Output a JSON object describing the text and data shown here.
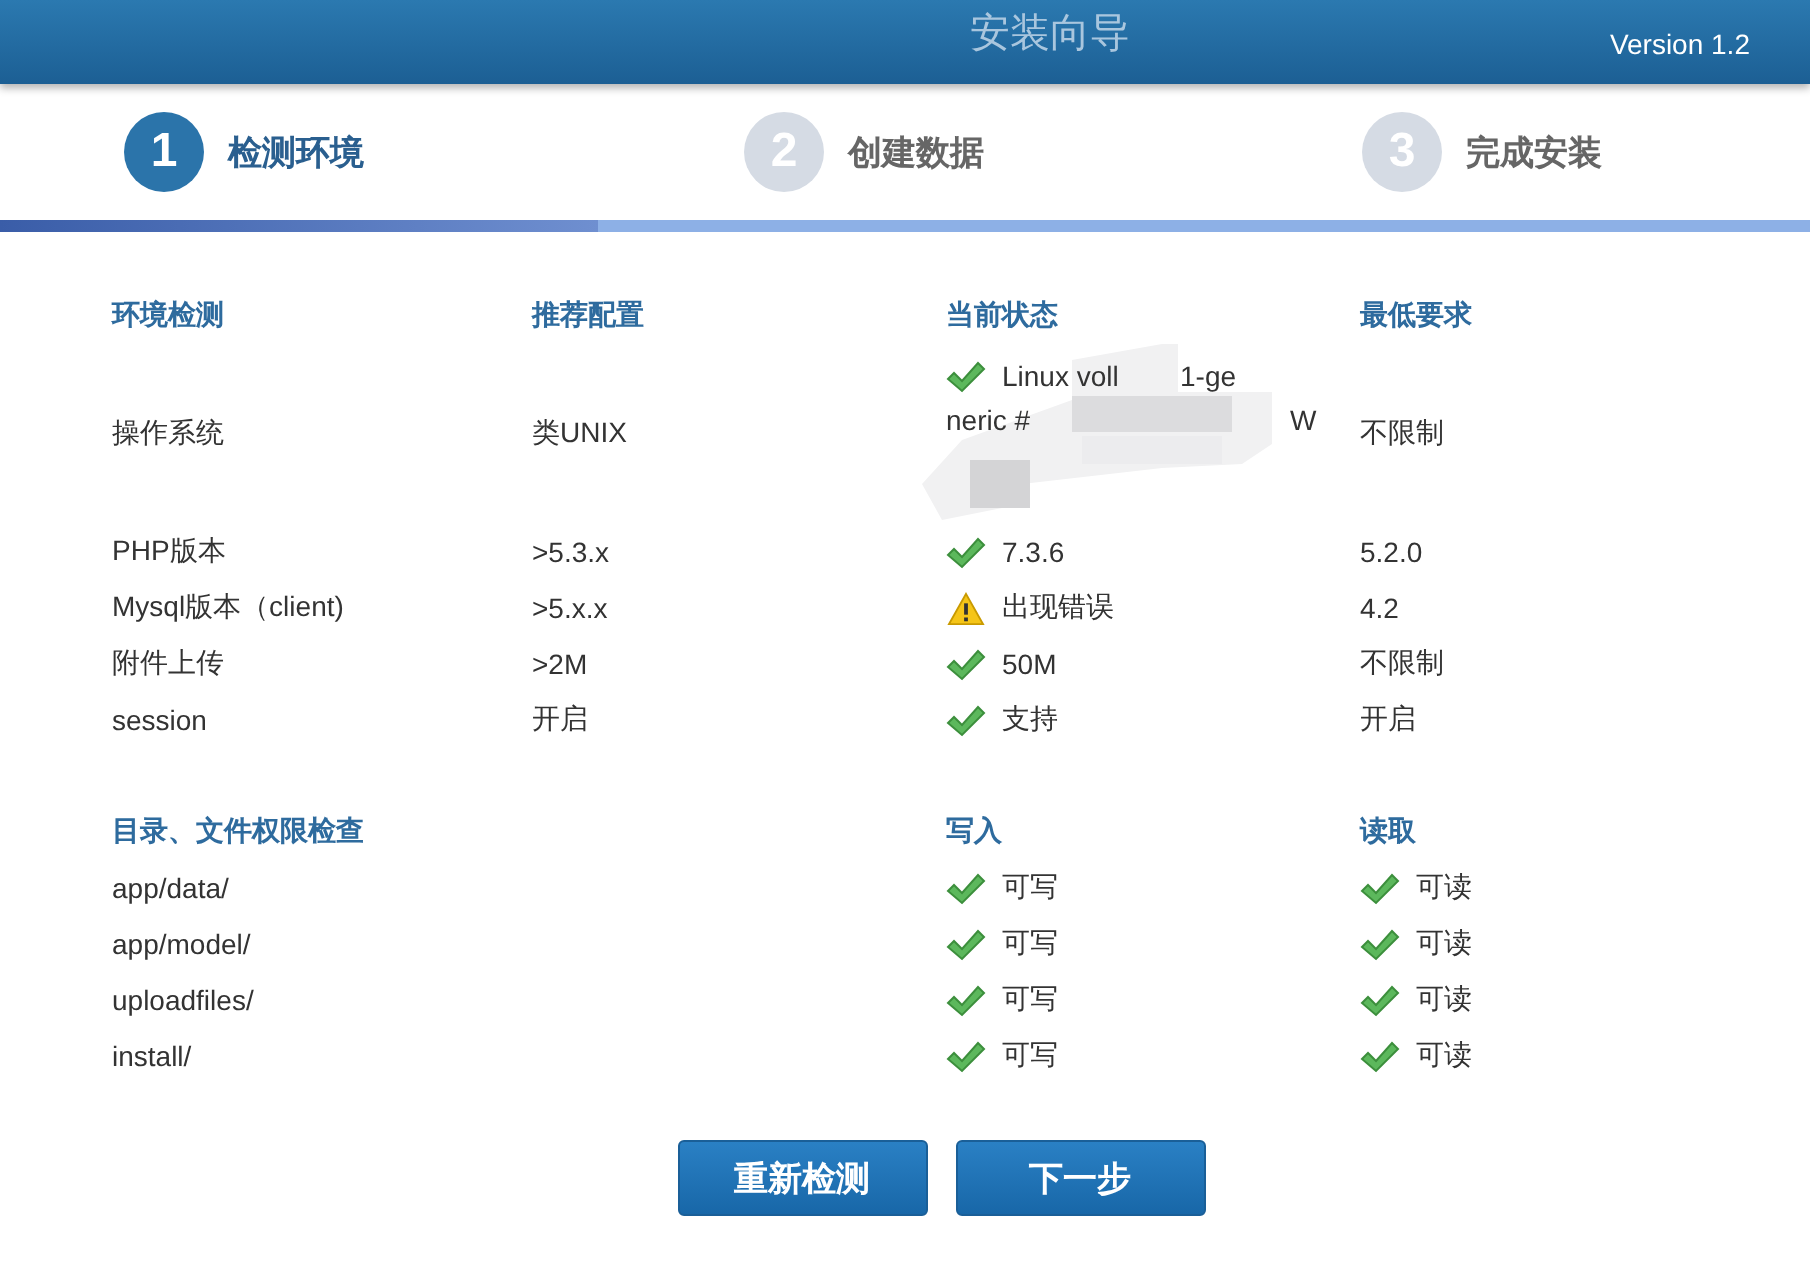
{
  "header": {
    "subtitle": "安装向导",
    "version": "Version 1.2"
  },
  "steps": [
    {
      "number": "1",
      "label": "检测环境",
      "selected": true
    },
    {
      "number": "2",
      "label": "创建数据",
      "selected": false
    },
    {
      "number": "3",
      "label": "完成安装",
      "selected": false
    }
  ],
  "progress": {
    "level": 0.33
  },
  "environment": {
    "columns": [
      "环境检测",
      "推荐配置",
      "当前状态",
      "最低要求"
    ],
    "rows": [
      {
        "name": "操作系统",
        "recommended": "类UNIX",
        "kind": "ok",
        "current_lines": [
          [
            "Linux voll",
            "1-ge"
          ],
          [
            "neric #",
            "W"
          ]
        ],
        "minimum": "不限制"
      },
      {
        "name": "PHP版本",
        "recommended": ">5.3.x",
        "kind": "ok",
        "current": "7.3.6",
        "minimum": "5.2.0"
      },
      {
        "name": "Mysql版本（client)",
        "recommended": ">5.x.x",
        "kind": "error",
        "current": "出现错误",
        "minimum": "4.2"
      },
      {
        "name": "附件上传",
        "recommended": ">2M",
        "kind": "ok",
        "current": "50M",
        "minimum": "不限制"
      },
      {
        "name": "session",
        "recommended": "开启",
        "kind": "ok",
        "current": "支持",
        "minimum": "开启"
      }
    ]
  },
  "permissions": {
    "title": "目录、文件权限检查",
    "write_heading": "写入",
    "read_heading": "读取",
    "rows": [
      {
        "path": "app/data/",
        "write": {
          "ok": true,
          "text": "可写"
        },
        "read": {
          "ok": true,
          "text": "可读"
        }
      },
      {
        "path": "app/model/",
        "write": {
          "ok": true,
          "text": "可写"
        },
        "read": {
          "ok": true,
          "text": "可读"
        }
      },
      {
        "path": "uploadfiles/",
        "write": {
          "ok": true,
          "text": "可写"
        },
        "read": {
          "ok": true,
          "text": "可读"
        }
      },
      {
        "path": "install/",
        "write": {
          "ok": true,
          "text": "可写"
        },
        "read": {
          "ok": true,
          "text": "可读"
        }
      }
    ]
  },
  "buttons": [
    "重新检测",
    "下一步"
  ]
}
